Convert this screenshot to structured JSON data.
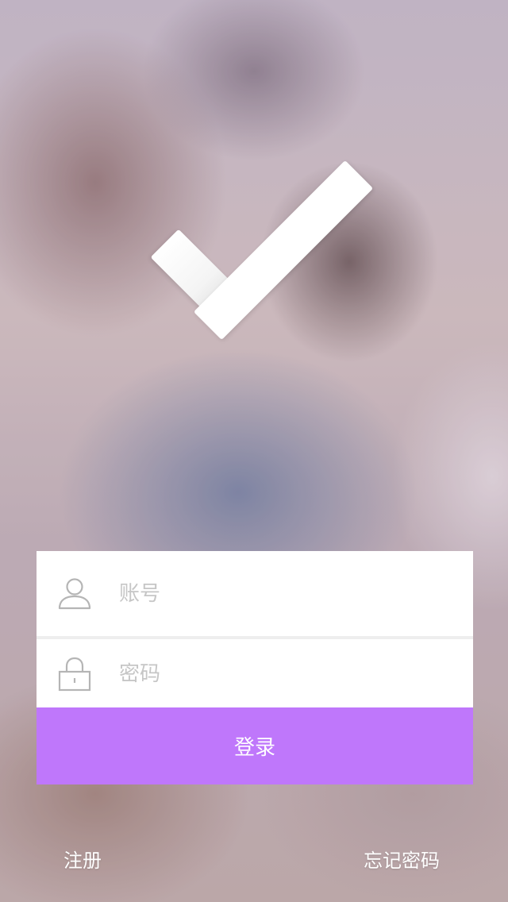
{
  "colors": {
    "accent": "#bf77fb",
    "card_background": "#ffffff",
    "placeholder": "#c6c6c6",
    "icon_stroke": "#b5b5b5",
    "link_text": "#ffffff"
  },
  "logo": {
    "icon": "checkmark-icon"
  },
  "login_form": {
    "account": {
      "icon": "user-icon",
      "placeholder": "账号",
      "value": ""
    },
    "password": {
      "icon": "lock-icon",
      "placeholder": "密码",
      "value": ""
    },
    "submit_label": "登录"
  },
  "footer": {
    "register_label": "注册",
    "forgot_password_label": "忘记密码"
  }
}
